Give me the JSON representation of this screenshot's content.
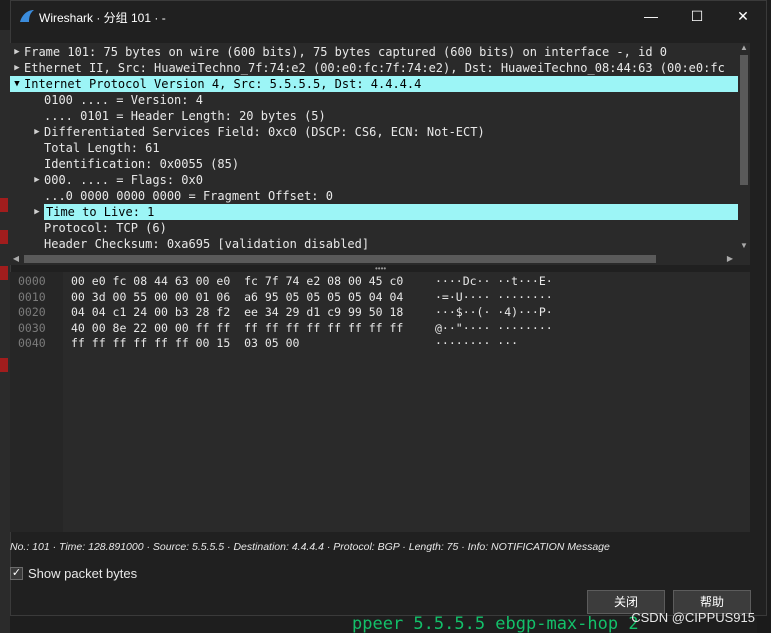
{
  "window": {
    "title": "Wireshark · 分组 101 · -"
  },
  "tree": {
    "rows": [
      {
        "expand": "collapsed",
        "text": "Frame 101: 75 bytes on wire (600 bits), 75 bytes captured (600 bits) on interface -, id 0"
      },
      {
        "expand": "collapsed",
        "text": "Ethernet II, Src: HuaweiTechno_7f:74:e2 (00:e0:fc:7f:74:e2), Dst: HuaweiTechno_08:44:63 (00:e0:fc"
      },
      {
        "expand": "expanded",
        "text": "Internet Protocol Version 4, Src: 5.5.5.5, Dst: 4.4.4.4",
        "selected": true
      },
      {
        "expand": "none",
        "text": "0100 .... = Version: 4"
      },
      {
        "expand": "none",
        "text": ".... 0101 = Header Length: 20 bytes (5)"
      },
      {
        "expand": "collapsed",
        "text": "Differentiated Services Field: 0xc0 (DSCP: CS6, ECN: Not-ECT)"
      },
      {
        "expand": "none",
        "text": "Total Length: 61"
      },
      {
        "expand": "none",
        "text": "Identification: 0x0055 (85)"
      },
      {
        "expand": "collapsed",
        "text": "000. .... = Flags: 0x0"
      },
      {
        "expand": "none",
        "text": "...0 0000 0000 0000 = Fragment Offset: 0"
      },
      {
        "expand": "collapsed",
        "text": "Time to Live: 1",
        "highlight": true
      },
      {
        "expand": "none",
        "text": "Protocol: TCP (6)"
      },
      {
        "expand": "none",
        "text": "Header Checksum: 0xa695 [validation disabled]"
      }
    ]
  },
  "bytes": {
    "rows": [
      {
        "offset": "0000",
        "hex": "00 e0 fc 08 44 63 00 e0  fc 7f 74 e2 08 00 45 c0",
        "ascii": "····Dc·· ··t···E·"
      },
      {
        "offset": "0010",
        "hex": "00 3d 00 55 00 00 01 06  a6 95 05 05 05 05 04 04",
        "ascii": "·=·U···· ········"
      },
      {
        "offset": "0020",
        "hex": "04 04 c1 24 00 b3 28 f2  ee 34 29 d1 c9 99 50 18",
        "ascii": "···$··(· ·4)···P·"
      },
      {
        "offset": "0030",
        "hex": "40 00 8e 22 00 00 ff ff  ff ff ff ff ff ff ff ff",
        "ascii": "@··\"···· ········"
      },
      {
        "offset": "0040",
        "hex": "ff ff ff ff ff ff 00 15  03 05 00",
        "ascii": "········ ···"
      }
    ]
  },
  "status": "No.: 101 · Time: 128.891000 · Source: 5.5.5.5 · Destination: 4.4.4.4 · Protocol: BGP · Length: 75 · Info: NOTIFICATION Message",
  "options": {
    "show_bytes_label": "Show packet bytes",
    "show_bytes_checked": true
  },
  "buttons": {
    "close": "关闭",
    "help": "帮助"
  },
  "background": {
    "terminal_line": "ppeer 5.5.5.5 ebgp-max-hop 2",
    "watermark": "CSDN @CIPPUS915"
  },
  "colors": {
    "selection": "#9cf5f6",
    "terminal_text": "#13c06a"
  }
}
